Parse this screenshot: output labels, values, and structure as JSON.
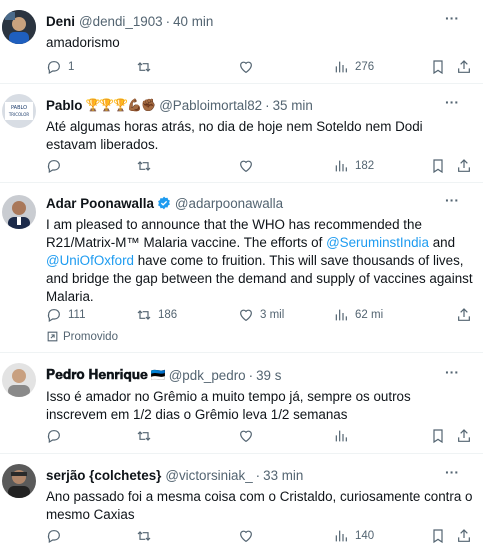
{
  "tweets": [
    {
      "name": "Deni",
      "emojis": "",
      "handle": "@dendi_1903",
      "time": "40 min",
      "text": "amadorismo",
      "replies": "1",
      "retweets": "",
      "likes": "",
      "views": "276",
      "verified": false
    },
    {
      "name": "Pablo",
      "emojis": "🏆🏆🏆💪🏾✊🏾",
      "handle": "@Pabloimortal82",
      "time": "35 min",
      "text": "Até algumas horas atrás, no dia de hoje nem Soteldo nem Dodi estavam liberados.",
      "replies": "",
      "retweets": "",
      "likes": "",
      "views": "182",
      "verified": false
    },
    {
      "name": "Adar Poonawalla",
      "emojis": "",
      "handle": "@adarpoonawalla",
      "time": "",
      "text_parts": [
        "I am pleased to announce that the WHO has recommended the R21/Matrix-M™ Malaria vaccine. The efforts of ",
        "@SeruminstIndia",
        " and ",
        "@UniOfOxford",
        " have come to fruition. This will save thousands of lives, and bridge the gap between the demand and supply of vaccines against Malaria."
      ],
      "replies": "111",
      "retweets": "186",
      "likes": "3 mil",
      "views": "62 mi",
      "promoted": "Promovido",
      "verified": true
    },
    {
      "name": "𝐏𝐞𝐝𝐫𝐨 𝐇𝐞𝐧𝐫𝐢𝐪𝐮𝐞",
      "emojis": "🇪🇪",
      "handle": "@pdk_pedro",
      "time": "39 s",
      "text": "Isso é amador no Grêmio a muito tempo já, sempre os outros inscrevem em 1/2 dias o Grêmio leva 1/2 semanas",
      "replies": "",
      "retweets": "",
      "likes": "",
      "views": "",
      "verified": false
    },
    {
      "name": "serjão {colchetes}",
      "emojis": "",
      "handle": "@victorsiniak_",
      "time": "33 min",
      "text": "Ano passado foi a mesma coisa com o Cristaldo, curiosamente contra o mesmo Caxias",
      "replies": "",
      "retweets": "",
      "likes": "",
      "views": "140",
      "verified": false
    }
  ],
  "colors": {
    "text": "#0f1419",
    "secondary": "#536471",
    "link": "#1d9bf0",
    "divider": "#eff3f4"
  }
}
